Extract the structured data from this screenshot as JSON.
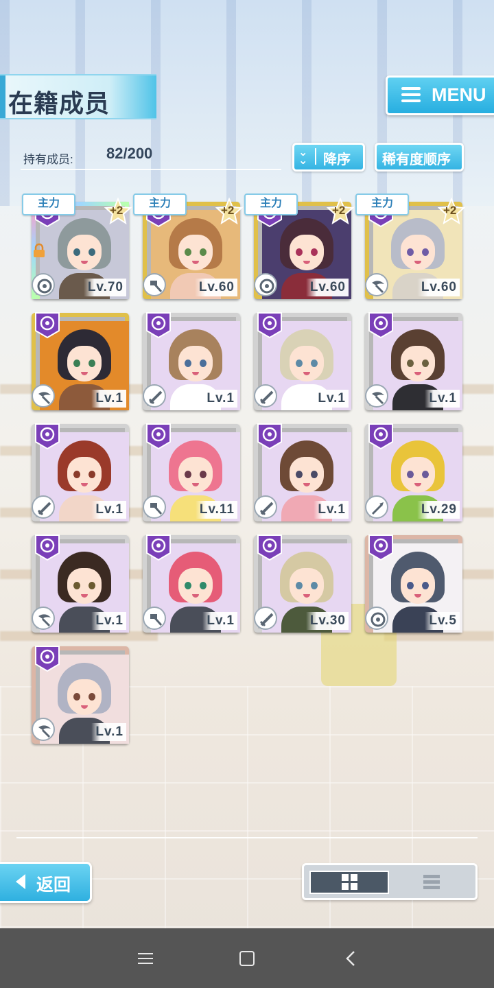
{
  "header": {
    "title": "在籍成员",
    "menu_label": "MENU"
  },
  "count": {
    "label": "持有成员:",
    "value": "82/200"
  },
  "sort": {
    "order_label": "降序",
    "rarity_label": "稀有度顺序"
  },
  "lead_tag": "主力",
  "plus_tag": "+2",
  "cards": [
    {
      "level": "Lv.70",
      "frame": "rainbow",
      "lead": true,
      "plus": true,
      "locked": true,
      "hair": "#8e9a9c",
      "bg": "#c7c8d8",
      "eye": "#3c6b7d",
      "body": "#6a5a4c",
      "type": "sniper"
    },
    {
      "level": "Lv.60",
      "frame": "gold",
      "lead": true,
      "plus": true,
      "locked": false,
      "hair": "#b57a48",
      "bg": "#e7b97a",
      "eye": "#5b8a4a",
      "body": "#f1c9b4",
      "type": "hammer"
    },
    {
      "level": "Lv.60",
      "frame": "gold",
      "lead": true,
      "plus": true,
      "locked": false,
      "hair": "#4a2c3a",
      "bg": "#4b3e6e",
      "eye": "#a9325a",
      "body": "#8a2d3a",
      "type": "sniper"
    },
    {
      "level": "Lv.60",
      "frame": "gold",
      "lead": true,
      "plus": true,
      "locked": false,
      "hair": "#b8bcc9",
      "bg": "#f1e4b9",
      "eye": "#6f5ca6",
      "body": "#d9d3c8",
      "type": "scythe"
    },
    {
      "level": "Lv.1",
      "frame": "gold",
      "lead": false,
      "plus": false,
      "locked": false,
      "hair": "#2d2a35",
      "bg": "#e38a2a",
      "eye": "#3b7f55",
      "body": "#8d5a3b",
      "type": "scythe"
    },
    {
      "level": "Lv.1",
      "frame": "silver",
      "lead": false,
      "plus": false,
      "locked": false,
      "hair": "#a8825d",
      "bg": "#e7d7f2",
      "eye": "#4b6f9a",
      "body": "#ffffff",
      "type": "blade"
    },
    {
      "level": "Lv.1",
      "frame": "silver",
      "lead": false,
      "plus": false,
      "locked": false,
      "hair": "#d9d2b6",
      "bg": "#e7d7f2",
      "eye": "#5d8aa6",
      "body": "#ffffff",
      "type": "blade"
    },
    {
      "level": "Lv.1",
      "frame": "silver",
      "lead": false,
      "plus": false,
      "locked": false,
      "hair": "#5a4032",
      "bg": "#e7d7f2",
      "eye": "#6b6140",
      "body": "#2e2e33",
      "type": "scythe"
    },
    {
      "level": "Lv.1",
      "frame": "silver",
      "lead": false,
      "plus": false,
      "locked": false,
      "hair": "#9a3a2a",
      "bg": "#e7d7f2",
      "eye": "#8a3a2a",
      "body": "#f2d6c8",
      "type": "blade"
    },
    {
      "level": "Lv.11",
      "frame": "silver",
      "lead": false,
      "plus": false,
      "locked": false,
      "hair": "#ee7590",
      "bg": "#e7d7f2",
      "eye": "#6a3a4a",
      "body": "#f6e07a",
      "type": "hammer"
    },
    {
      "level": "Lv.1",
      "frame": "silver",
      "lead": false,
      "plus": false,
      "locked": false,
      "hair": "#6e4a36",
      "bg": "#e7d7f2",
      "eye": "#4a4a66",
      "body": "#f0a9b4",
      "type": "blade"
    },
    {
      "level": "Lv.29",
      "frame": "silver",
      "lead": false,
      "plus": false,
      "locked": false,
      "hair": "#e9c43a",
      "bg": "#e7d7f2",
      "eye": "#6a5a9a",
      "body": "#8ac24a",
      "type": "spear"
    },
    {
      "level": "Lv.1",
      "frame": "silver",
      "lead": false,
      "plus": false,
      "locked": false,
      "hair": "#3b2a22",
      "bg": "#e7d7f2",
      "eye": "#6b5a30",
      "body": "#4a4e59",
      "type": "scythe"
    },
    {
      "level": "Lv.1",
      "frame": "silver",
      "lead": false,
      "plus": false,
      "locked": false,
      "hair": "#e65c77",
      "bg": "#e7d7f2",
      "eye": "#2f8a6a",
      "body": "#4a4e59",
      "type": "hammer"
    },
    {
      "level": "Lv.30",
      "frame": "silver",
      "lead": false,
      "plus": false,
      "locked": false,
      "hair": "#d5c9a3",
      "bg": "#e7d7f2",
      "eye": "#5d8aa6",
      "body": "#4d5a3c",
      "type": "blade"
    },
    {
      "level": "Lv.5",
      "frame": "bronze",
      "lead": false,
      "plus": false,
      "locked": false,
      "hair": "#4f5a6e",
      "bg": "#f4f1f4",
      "eye": "#4a5a8a",
      "body": "#3a4256",
      "type": "sniper"
    },
    {
      "level": "Lv.1",
      "frame": "bronze",
      "lead": false,
      "plus": false,
      "locked": false,
      "hair": "#b0b3c4",
      "bg": "#f1dede",
      "eye": "#7a4a3a",
      "body": "#4a4e59",
      "type": "scythe"
    }
  ],
  "footer": {
    "back_label": "返回"
  },
  "colors": {
    "accent": "#2fb0e0",
    "attr_purple": "#7a3fb8"
  }
}
